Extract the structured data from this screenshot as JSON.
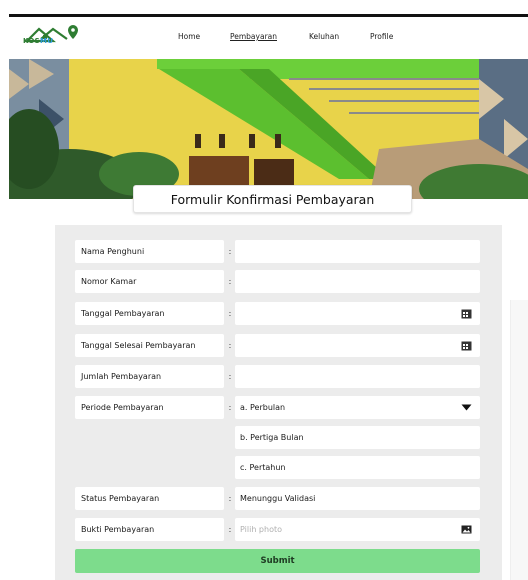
{
  "brand": {
    "part1": "KOS",
    "part2": "MU"
  },
  "nav": [
    {
      "label": "Home",
      "active": false
    },
    {
      "label": "Pembayaran",
      "active": true
    },
    {
      "label": "Keluhan",
      "active": false
    },
    {
      "label": "Profile",
      "active": false
    }
  ],
  "form": {
    "title": "Formulir Konfirmasi Pembayaran",
    "separator": ":",
    "fields": [
      {
        "label": "Nama Penghuni",
        "value": ""
      },
      {
        "label": "Nomor Kamar",
        "value": ""
      },
      {
        "label": "Tanggal Pembayaran",
        "value": "",
        "icon": "calendar-icon"
      },
      {
        "label": "Tanggal Selesai Pembayaran",
        "value": "",
        "icon": "calendar-icon"
      },
      {
        "label": "Jumlah Pembayaran",
        "value": ""
      },
      {
        "label": "Periode Pembayaran",
        "value": "a. Perbulan",
        "icon": "chevron-down-icon"
      },
      {
        "label": "Status Pembayaran",
        "value": "Menunggu Validasi"
      },
      {
        "label": "Bukti Pembayaran",
        "placeholder": "Pilih photo",
        "icon": "image-icon"
      }
    ],
    "period_options": [
      "a. Perbulan",
      "b. Pertiga Bulan",
      "c. Pertahun"
    ],
    "submit_label": "Submit"
  },
  "colors": {
    "accent": "#7ddc8c",
    "brand_green": "#2e7d32",
    "brand_blue": "#2e9be0"
  }
}
